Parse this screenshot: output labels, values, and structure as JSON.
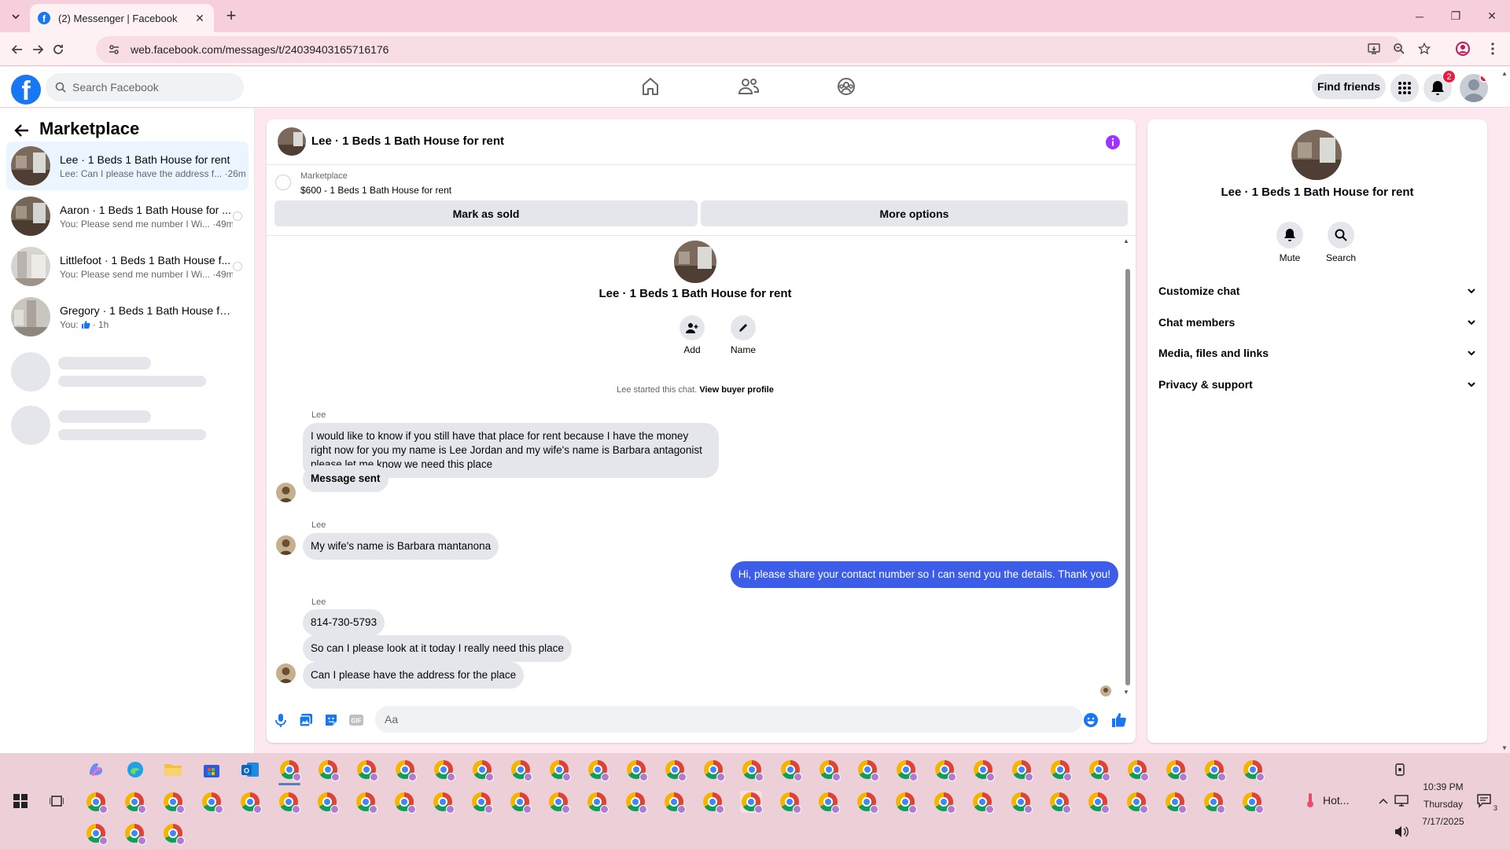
{
  "browser": {
    "tab_title": "(2) Messenger | Facebook",
    "url": "web.facebook.com/messages/t/24039403165716176"
  },
  "fb_header": {
    "search_placeholder": "Search Facebook",
    "find_friends": "Find friends",
    "notifications_count": "2"
  },
  "sidebar": {
    "title": "Marketplace",
    "conversations": [
      {
        "name": "Lee · 1 Beds 1 Bath House for rent",
        "snippet": "Lee: Can I please have the address f... ·26m",
        "active": true
      },
      {
        "name": "Aaron · 1 Beds 1 Bath House for ...",
        "snippet": "You: Please send me number I Wi... ·49m",
        "active": false
      },
      {
        "name": "Littlefoot · 1 Beds 1 Bath House f...",
        "snippet": "You: Please send me number I Wi... ·49m",
        "active": false
      },
      {
        "name": "Gregory · 1 Beds 1 Bath House for ...",
        "snippet_prefix": "You:",
        "snippet_suffix": "· 1h",
        "active": false
      }
    ]
  },
  "chat": {
    "title": "Lee · 1 Beds 1 Bath House for rent",
    "listing_source": "Marketplace",
    "listing_price_title": "$600 - 1 Beds 1 Bath House for rent",
    "mark_sold": "Mark as sold",
    "more_options": "More options",
    "intro_name": "Lee · 1 Beds 1 Bath House for rent",
    "add_label": "Add",
    "name_label": "Name",
    "started_text": "Lee started this chat.",
    "view_profile": "View buyer profile",
    "sender_name": "Lee",
    "messages": [
      {
        "from": "Lee",
        "text": "I would like to know if you still have that place for rent because I have the money right now for you my name is Lee Jordan and my wife's name is Barbara antagonist please let me know we need this place"
      },
      {
        "from": "Lee",
        "text": "Message sent"
      },
      {
        "from": "Lee",
        "text": "My wife's name is Barbara mantanona"
      },
      {
        "from": "me",
        "text": "Hi, please share your contact number so I can send you the details. Thank you!"
      },
      {
        "from": "Lee",
        "text": "814-730-5793"
      },
      {
        "from": "Lee",
        "text": "So can I please look at it today I really need this place"
      },
      {
        "from": "Lee",
        "text": "Can I please have the address for the place"
      }
    ],
    "input_placeholder": "Aa"
  },
  "details": {
    "name": "Lee · 1 Beds 1 Bath House for rent",
    "mute": "Mute",
    "search": "Search",
    "sections": [
      "Customize chat",
      "Chat members",
      "Media, files and links",
      "Privacy & support"
    ]
  },
  "taskbar": {
    "time": "10:39 PM",
    "day": "Thursday",
    "date": "7/17/2025",
    "weather": "Hot...",
    "notification_count": "3"
  },
  "colors": {
    "facebook_blue": "#1877f2",
    "outgoing_bubble": "#3b5de7",
    "info_purple": "#a033ff",
    "notif_red": "#e41e3f"
  }
}
